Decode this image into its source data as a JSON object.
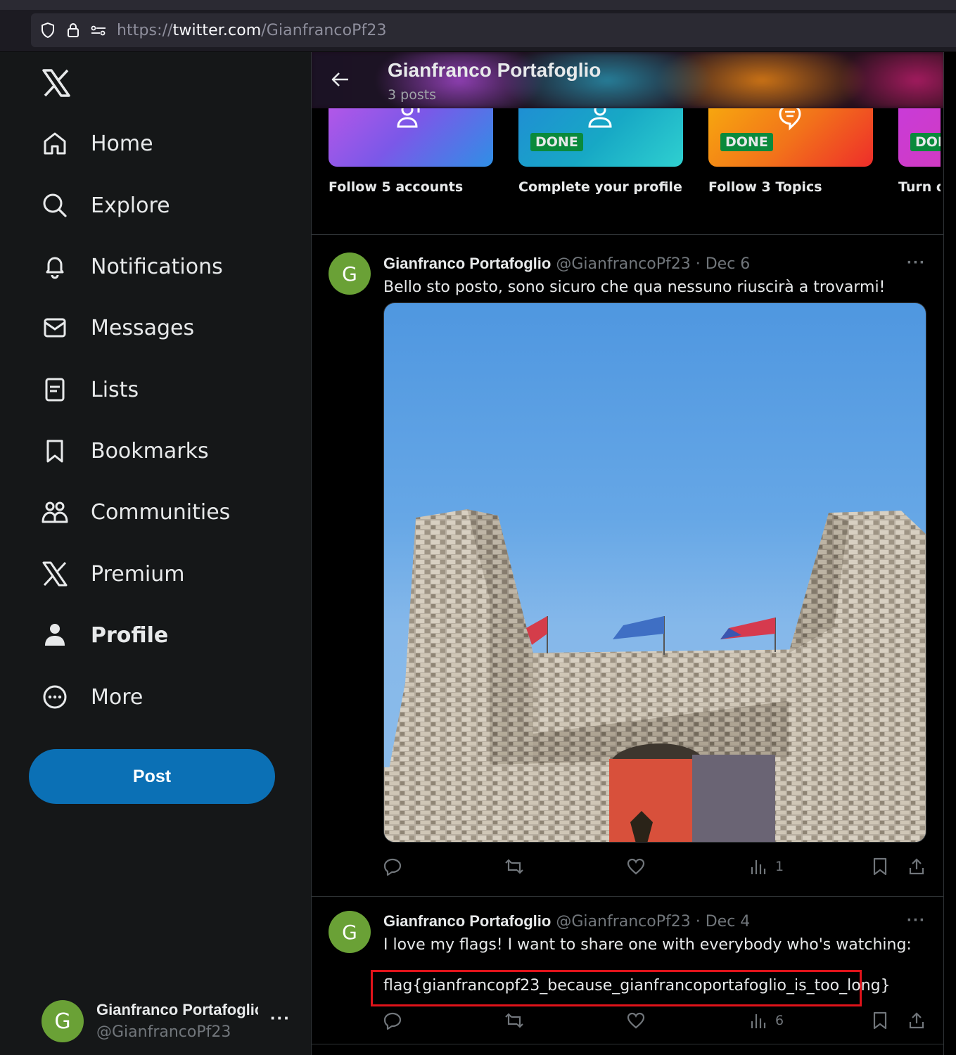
{
  "browser": {
    "url_scheme": "https://",
    "url_host": "twitter.com",
    "url_path": "/GianfrancoPf23"
  },
  "sidebar": {
    "items": [
      {
        "label": "Home",
        "icon": "home-icon"
      },
      {
        "label": "Explore",
        "icon": "search-icon"
      },
      {
        "label": "Notifications",
        "icon": "bell-icon"
      },
      {
        "label": "Messages",
        "icon": "envelope-icon"
      },
      {
        "label": "Lists",
        "icon": "list-icon"
      },
      {
        "label": "Bookmarks",
        "icon": "bookmark-icon"
      },
      {
        "label": "Communities",
        "icon": "people-icon"
      },
      {
        "label": "Premium",
        "icon": "x-logo-icon"
      },
      {
        "label": "Profile",
        "icon": "person-icon"
      },
      {
        "label": "More",
        "icon": "more-circle-icon"
      }
    ],
    "post_label": "Post",
    "account": {
      "name": "Gianfranco Portafoglio",
      "handle": "@GianfrancoPf23",
      "avatar_letter": "G"
    }
  },
  "header": {
    "title": "Gianfranco Portafoglio",
    "subtitle": "3 posts"
  },
  "cards": [
    {
      "label": "Follow 5 accounts",
      "badge": ""
    },
    {
      "label": "Complete your profile",
      "badge": "DONE"
    },
    {
      "label": "Follow 3 Topics",
      "badge": "DONE"
    },
    {
      "label": "Turn o",
      "badge": "DOI"
    }
  ],
  "posts": [
    {
      "avatar_letter": "G",
      "name": "Gianfranco Portafoglio",
      "handle": "@GianfrancoPf23",
      "separator": "·",
      "date": "Dec 6",
      "text": "Bello sto posto, sono sicuro che qua nessuno riuscirà a trovarmi!",
      "views": "1"
    },
    {
      "avatar_letter": "G",
      "name": "Gianfranco Portafoglio",
      "handle": "@GianfrancoPf23",
      "separator": "·",
      "date": "Dec 4",
      "text": "I love my flags! I want to share one with everybody who's watching:",
      "flag": "flag{gianfrancopf23_because_gianfrancoportafoglio_is_too_long}",
      "views": "6"
    }
  ],
  "colors": {
    "background": "#000000",
    "sidebar_bg": "#151718",
    "post_button": "#0b70b5",
    "avatar": "#6aa136",
    "done_badge": "#0a8a3c",
    "highlight_box": "#e0131a"
  }
}
